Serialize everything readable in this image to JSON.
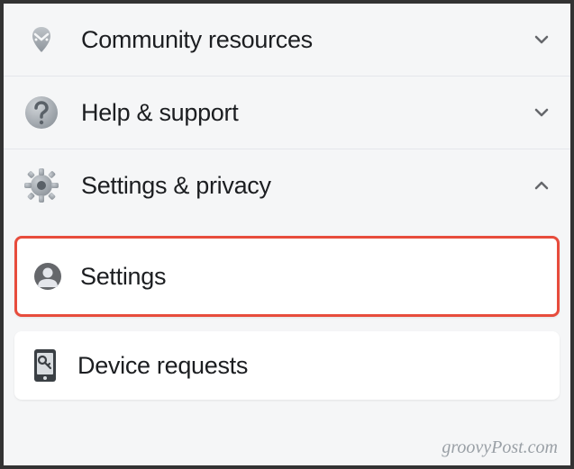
{
  "menu": [
    {
      "id": "community-resources",
      "label": "Community resources",
      "expanded": false,
      "icon": "handshake-icon"
    },
    {
      "id": "help-support",
      "label": "Help & support",
      "expanded": false,
      "icon": "question-icon"
    },
    {
      "id": "settings-privacy",
      "label": "Settings & privacy",
      "expanded": true,
      "icon": "gear-icon"
    }
  ],
  "submenu": [
    {
      "id": "settings",
      "label": "Settings",
      "icon": "person-icon",
      "highlighted": true
    },
    {
      "id": "device-requests",
      "label": "Device requests",
      "icon": "device-key-icon",
      "highlighted": false
    }
  ],
  "watermark": "groovyPost.com"
}
